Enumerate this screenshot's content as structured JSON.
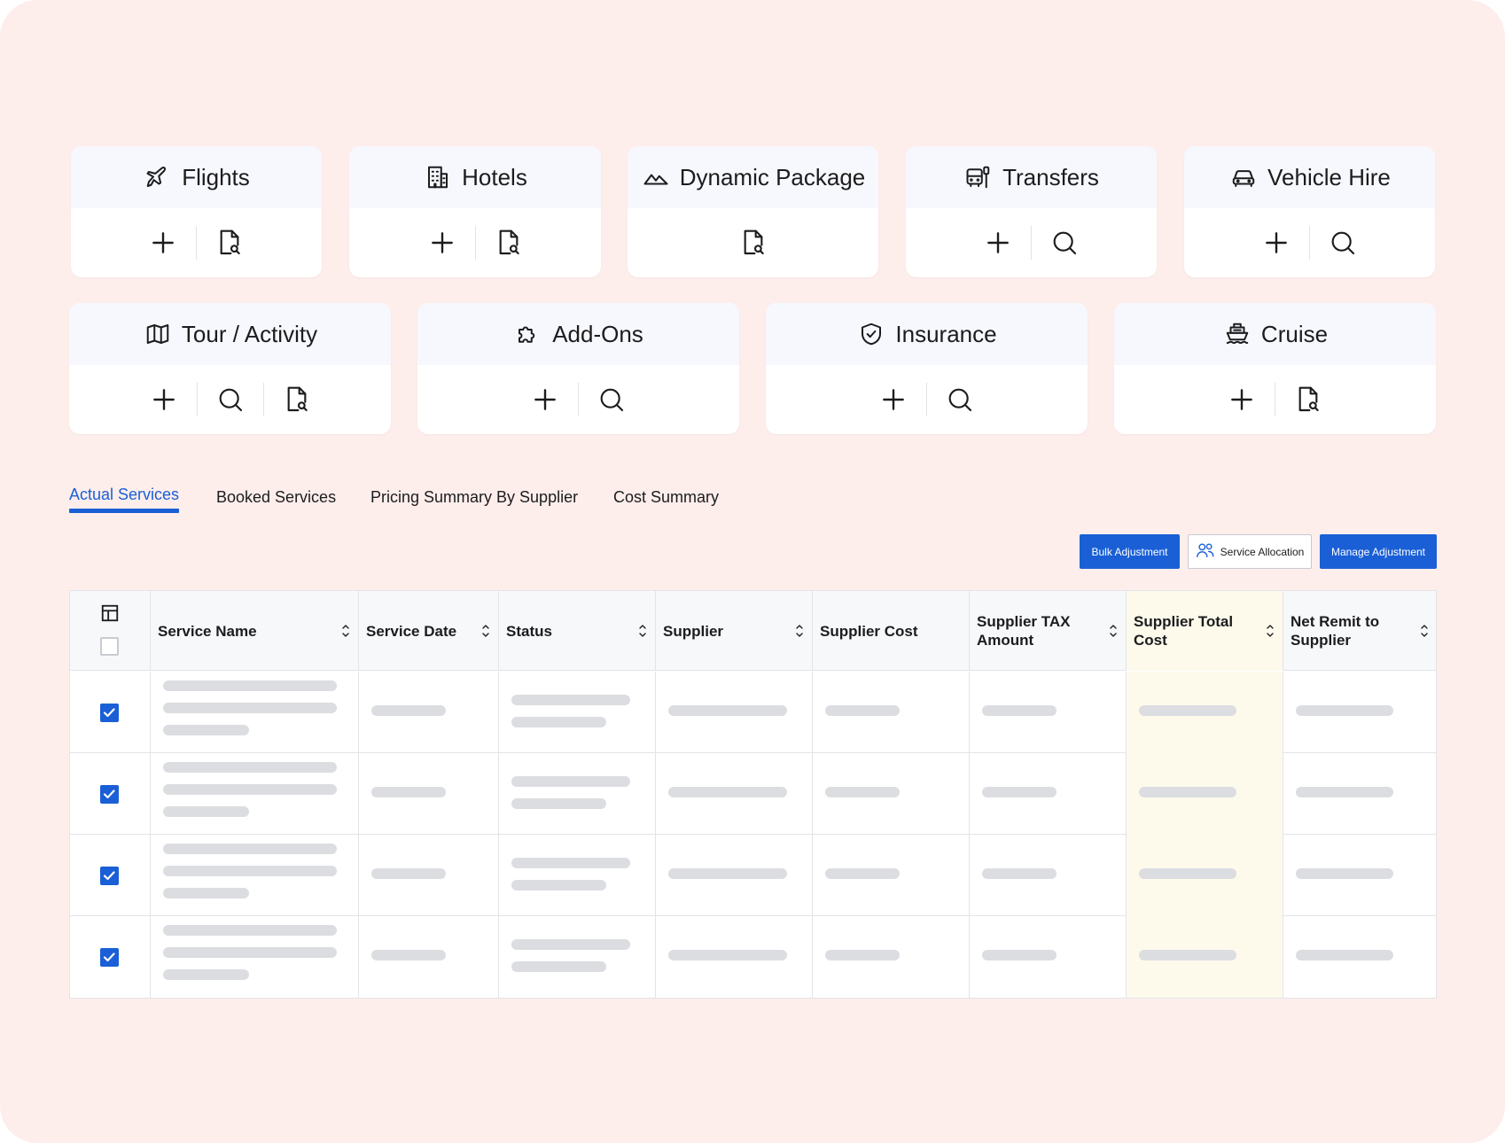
{
  "cards": [
    {
      "title": "Flights",
      "icon": "plane-icon",
      "actions": [
        "plus-icon",
        "document-search-icon"
      ]
    },
    {
      "title": "Hotels",
      "icon": "building-icon",
      "actions": [
        "plus-icon",
        "document-search-icon"
      ]
    },
    {
      "title": "Dynamic Package",
      "icon": "mountain-icon",
      "actions": [
        "document-search-icon"
      ]
    },
    {
      "title": "Transfers",
      "icon": "bus-stop-icon",
      "actions": [
        "plus-icon",
        "search-icon"
      ]
    },
    {
      "title": "Vehicle Hire",
      "icon": "car-icon",
      "actions": [
        "plus-icon",
        "search-icon"
      ]
    },
    {
      "title": "Tour / Activity",
      "icon": "map-icon",
      "actions": [
        "plus-icon",
        "search-icon",
        "document-search-icon"
      ]
    },
    {
      "title": "Add-Ons",
      "icon": "puzzle-icon",
      "actions": [
        "plus-icon",
        "search-icon"
      ]
    },
    {
      "title": "Insurance",
      "icon": "shield-check-icon",
      "actions": [
        "plus-icon",
        "search-icon"
      ]
    },
    {
      "title": "Cruise",
      "icon": "ship-icon",
      "actions": [
        "plus-icon",
        "document-search-icon"
      ]
    }
  ],
  "tabs": [
    {
      "label": "Actual Services",
      "active": true
    },
    {
      "label": "Booked Services",
      "active": false
    },
    {
      "label": "Pricing Summary By Supplier",
      "active": false
    },
    {
      "label": "Cost Summary",
      "active": false
    }
  ],
  "buttons": {
    "bulk_adjustment": "Bulk Adjustment",
    "service_allocation": "Service Allocation",
    "manage_adjustment": "Manage Adjustment"
  },
  "table": {
    "columns": [
      {
        "label": "Service Name",
        "sortable": true
      },
      {
        "label": "Service Date",
        "sortable": true
      },
      {
        "label": "Status",
        "sortable": true
      },
      {
        "label": "Supplier",
        "sortable": true
      },
      {
        "label": "Supplier Cost",
        "sortable": false
      },
      {
        "label": "Supplier TAX Amount",
        "sortable": true
      },
      {
        "label": "Supplier Total Cost",
        "sortable": true,
        "highlighted": true
      },
      {
        "label": "Net Remit to Supplier",
        "sortable": true
      }
    ],
    "rows": [
      {
        "checked": true
      },
      {
        "checked": true
      },
      {
        "checked": true
      },
      {
        "checked": true
      }
    ]
  },
  "colors": {
    "background": "#fdeeec",
    "accent": "#1a5fd6",
    "card_header": "#f7f8fd",
    "highlight_column": "#fdfaec",
    "skeleton": "#dcdde1"
  }
}
